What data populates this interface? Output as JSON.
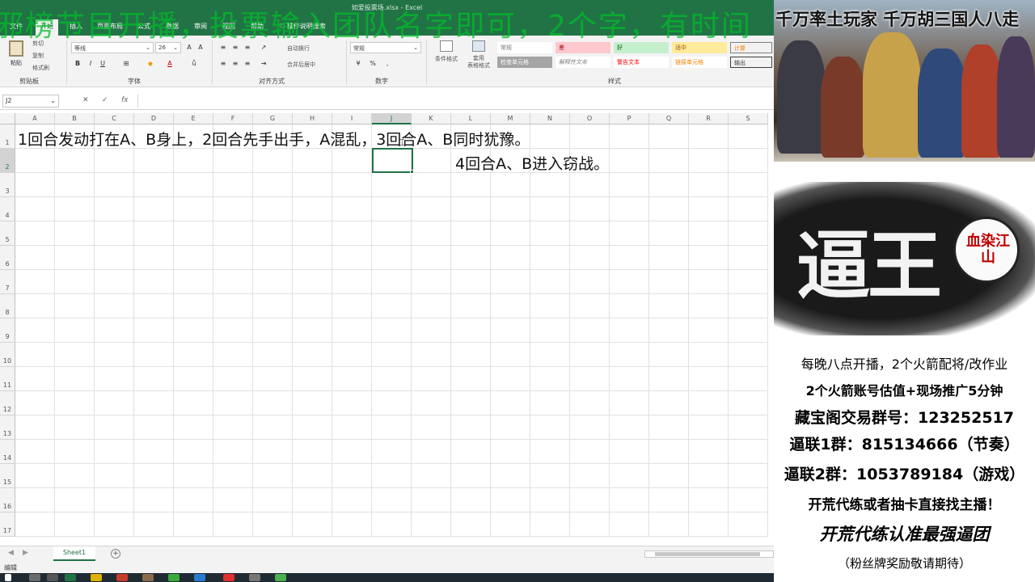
{
  "window": {
    "title": "如爱投票场.xlsx - Excel"
  },
  "ribbon": {
    "tabs": [
      "文件",
      "开始",
      "插入",
      "页面布局",
      "公式",
      "数据",
      "审阅",
      "视图",
      "帮助"
    ],
    "active_tab": "开始",
    "tell_me": "操作说明搜索",
    "clipboard": {
      "paste": "粘贴",
      "cut": "剪切",
      "copy": "复制",
      "format_painter": "格式刷",
      "label": "剪贴板"
    },
    "font": {
      "name": "等线",
      "size": "26",
      "bold": "B",
      "italic": "I",
      "underline": "U",
      "label": "字体"
    },
    "alignment": {
      "wrap": "自动换行",
      "merge": "合并后居中",
      "label": "对齐方式"
    },
    "number": {
      "format": "常规",
      "label": "数字"
    },
    "styles": {
      "conditional": "条件格式",
      "table": "套用\n表格格式",
      "cells": [
        "常规",
        "差",
        "好",
        "适中",
        "计算",
        "检查单元格",
        "解释性文本",
        "警告文本",
        "链接单元格",
        "输出"
      ],
      "label": "样式"
    }
  },
  "formula_bar": {
    "name_box": "J2",
    "cancel": "✕",
    "enter": "✓",
    "fx": "fx",
    "value": ""
  },
  "grid": {
    "columns": [
      "A",
      "B",
      "C",
      "D",
      "E",
      "F",
      "G",
      "H",
      "I",
      "J",
      "K",
      "L",
      "M",
      "N",
      "O",
      "P",
      "Q",
      "R",
      "S"
    ],
    "rows": [
      "1",
      "2",
      "3",
      "4",
      "5",
      "6",
      "7",
      "8",
      "9",
      "10",
      "11",
      "12",
      "13",
      "14",
      "15",
      "16",
      "17"
    ],
    "selected_column": "J",
    "selected_row": "2",
    "cells": {
      "A1": "1回合发动打在A、B身上，2回合先手出手，A混乱，3回合A、B同时犹豫。",
      "L2": "4回合A、B进入窃战。"
    }
  },
  "sheets": {
    "tabs": [
      "Sheet1"
    ],
    "add_label": "+"
  },
  "status": {
    "text": "编辑"
  },
  "overlay": {
    "marquee": "邪榜节目开播，投票输入团队名字即可，2个字，有时间"
  },
  "panel": {
    "banner_title": "千万率土玩家 千万胡三国人八走",
    "logo_main": "逼王",
    "logo_seal": "血染江山",
    "info_lines": [
      "每晚八点开播，2个火箭配将/改作业",
      "2个火箭账号估值+现场推广5分钟",
      "藏宝阁交易群号：123252517",
      "逼联1群：815134666（节奏）",
      "逼联2群：1053789184（游戏）",
      "开荒代练或者抽卡直接找主播！"
    ],
    "slogan": "开荒代练认准最强逼团",
    "note": "（粉丝牌奖励敬请期待）"
  },
  "colors": {
    "excel_green": "#217346",
    "marquee_green": "#00be28",
    "seal_red": "#c00000"
  }
}
